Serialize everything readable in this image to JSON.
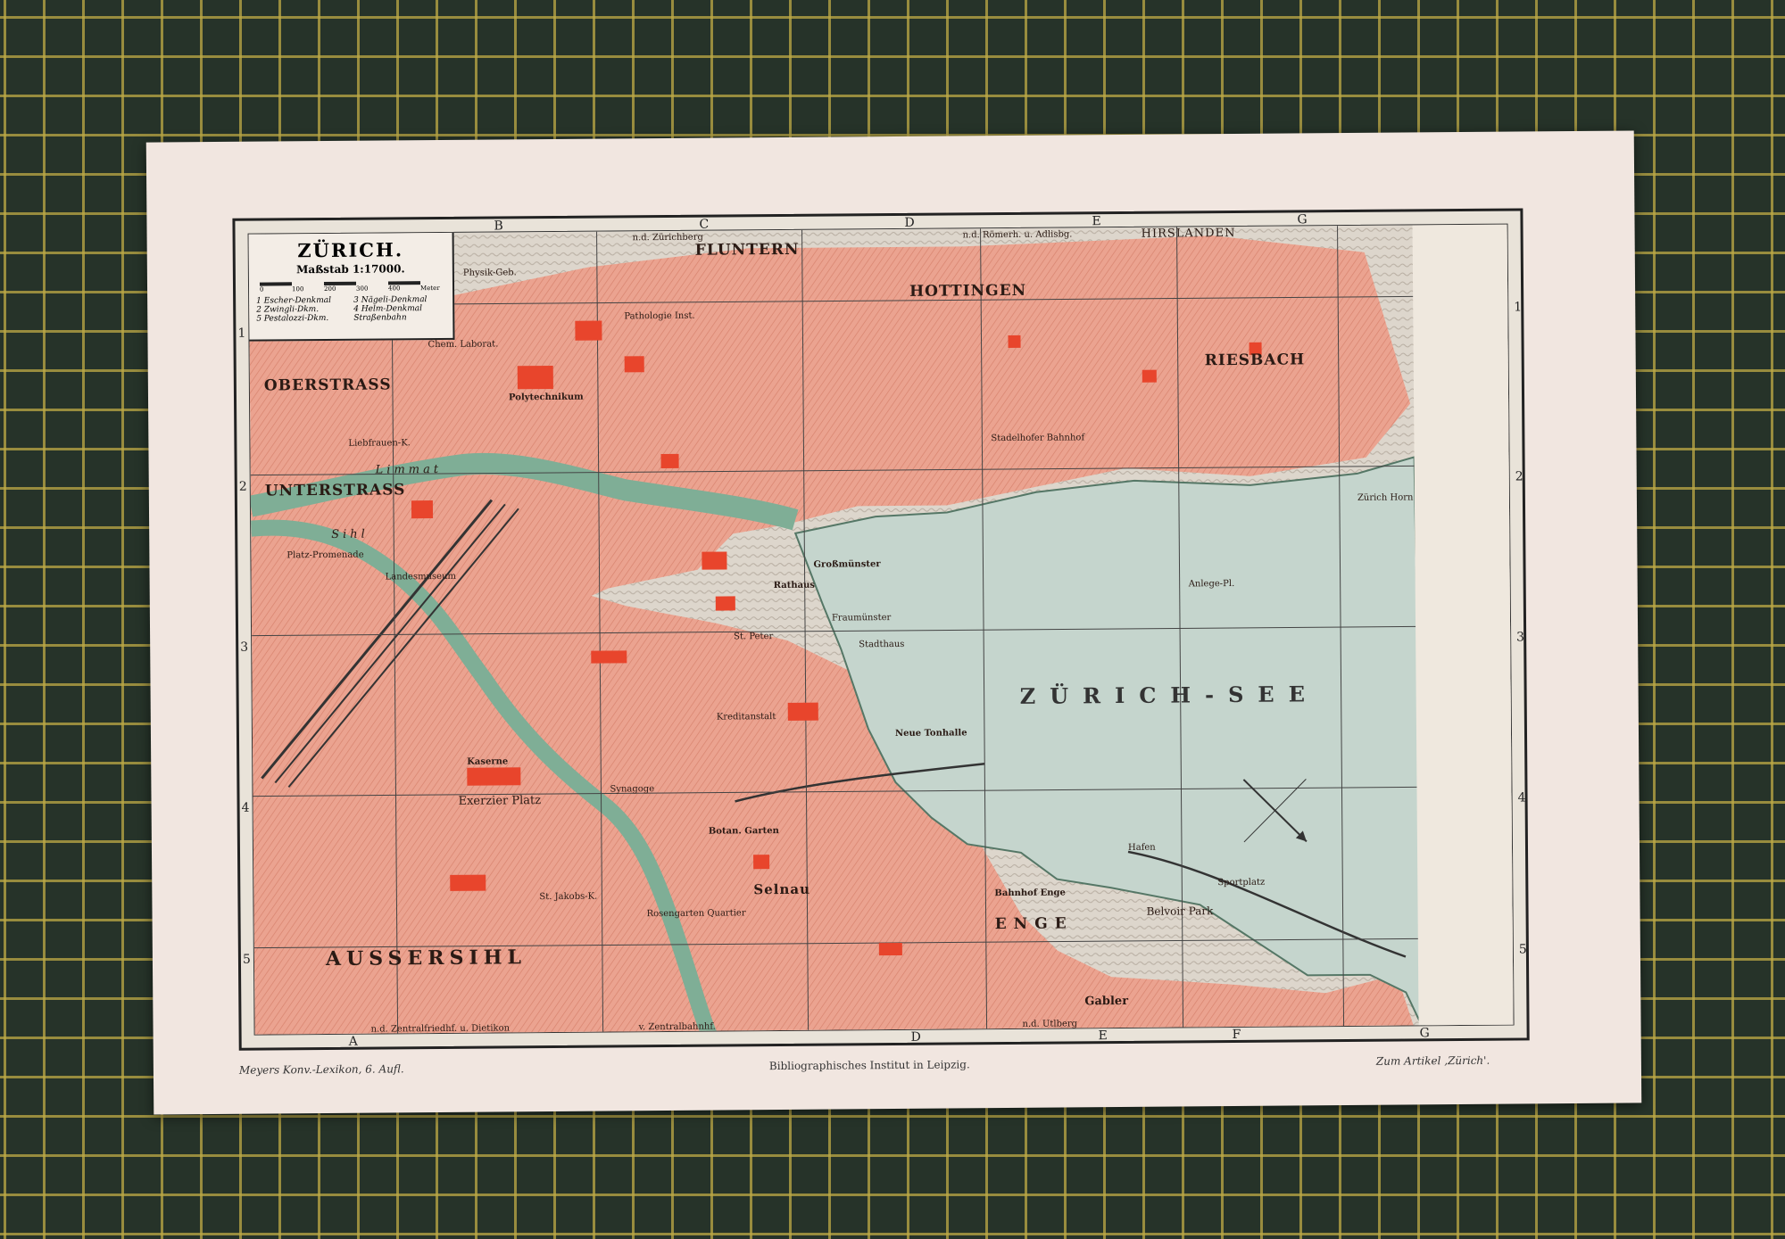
{
  "map": {
    "title": "ZÜRICH.",
    "scale": "Maßstab 1:17000.",
    "scale_ticks": [
      "0",
      "100",
      "200",
      "300",
      "400",
      "Meter"
    ],
    "legend_items": [
      "1 Escher-Denkmal",
      "3 Nägeli-Denkmal",
      "2 Zwingli-Dkm.",
      "4 Helm-Denkmal",
      "5 Pestalozzi-Dkm.",
      "Straßenbahn"
    ],
    "column_labels": [
      "A",
      "B",
      "C",
      "D",
      "E",
      "F",
      "G"
    ],
    "row_labels": [
      "1",
      "2",
      "3",
      "4",
      "5"
    ],
    "top_notes": [
      "n.d. Zürichberg",
      "n.d. Römerh. u. Adlisbg.",
      "HIRSLANDEN"
    ],
    "bottom_notes": [
      "n.d. Zentralfriedhf. u. Dietikon",
      "v. Zentralbahnhf.",
      "n.d. Utlberg"
    ],
    "districts": [
      "OBERSTRASS",
      "UNTERSTRASS",
      "FLUNTERN",
      "HOTTINGEN",
      "RIESBACH",
      "AUSSERSIHL",
      "ENGE",
      "Selnau"
    ],
    "water": [
      "ZÜRICH-SEE",
      "Limmat",
      "Sihl"
    ],
    "places": [
      "Physik-Geb.",
      "Chem. Laborat.",
      "Polytechnikum",
      "Liebfrauen-K.",
      "Pathologie Inst.",
      "Rathaus",
      "Großmünster",
      "St. Peter",
      "Fraumünster",
      "Stadthaus",
      "Neue Tonhalle",
      "Bahnhof Enge",
      "Kaserne",
      "Exerzier Platz",
      "Rosengarten Quartier",
      "St. Jakobs-K.",
      "Synagoge",
      "Stadelhofer Bahnhof",
      "Belvoir Park",
      "Zürich Horn",
      "Platz-Promenade",
      "Landesmuseum",
      "Botan. Garten",
      "Kreditanstalt",
      "Hafen",
      "Anlege-Pl.",
      "Sportplatz",
      "Gabler"
    ],
    "accent_colors": {
      "built": "#eba390",
      "important": "#e8452c",
      "water": "#c5d5cd",
      "river": "#7fae96"
    }
  },
  "footer": {
    "left": "Meyers Konv.-Lexikon, 6. Aufl.",
    "center": "Bibliographisches Institut in Leipzig.",
    "right": "Zum Artikel ‚Zürich'."
  }
}
